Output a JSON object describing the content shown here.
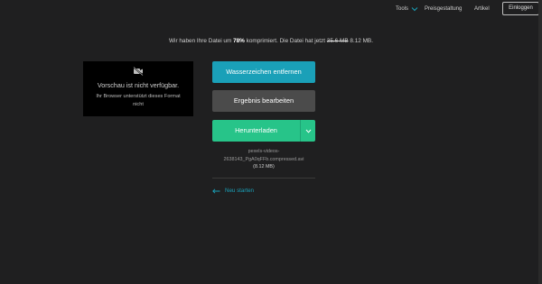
{
  "nav": {
    "tools": "Tools",
    "pricing": "Preisgestaltung",
    "article": "Artikel",
    "login": "Einloggen"
  },
  "info": {
    "prefix": "Wir haben Ihre Datei um",
    "percent": "78%",
    "mid": "komprimiert. Die Datei hat jetzt",
    "old_size": "35.6 MB",
    "new_size": "8.12 MB."
  },
  "preview": {
    "title": "Vorschau ist nicht verfügbar.",
    "subtitle": "Ihr Browser unterstützt dieses Format nicht"
  },
  "actions": {
    "watermark": "Wasserzeichen entfernen",
    "edit": "Ergebnis bearbeiten",
    "download": "Herunterladen"
  },
  "file": {
    "line1": "pexels-videos-",
    "line2": "2638143_PgA0qFFb.compressed.avi",
    "size": "(8.12 MB)"
  },
  "restart": "Neu starten",
  "colors": {
    "background": "#1f1f20",
    "accent_blue": "#1aa0b8",
    "accent_green": "#27c489",
    "neutral_button": "#4b4b4b"
  },
  "icons": [
    "chevron-down-icon",
    "video-off-icon",
    "arrow-left-icon"
  ]
}
